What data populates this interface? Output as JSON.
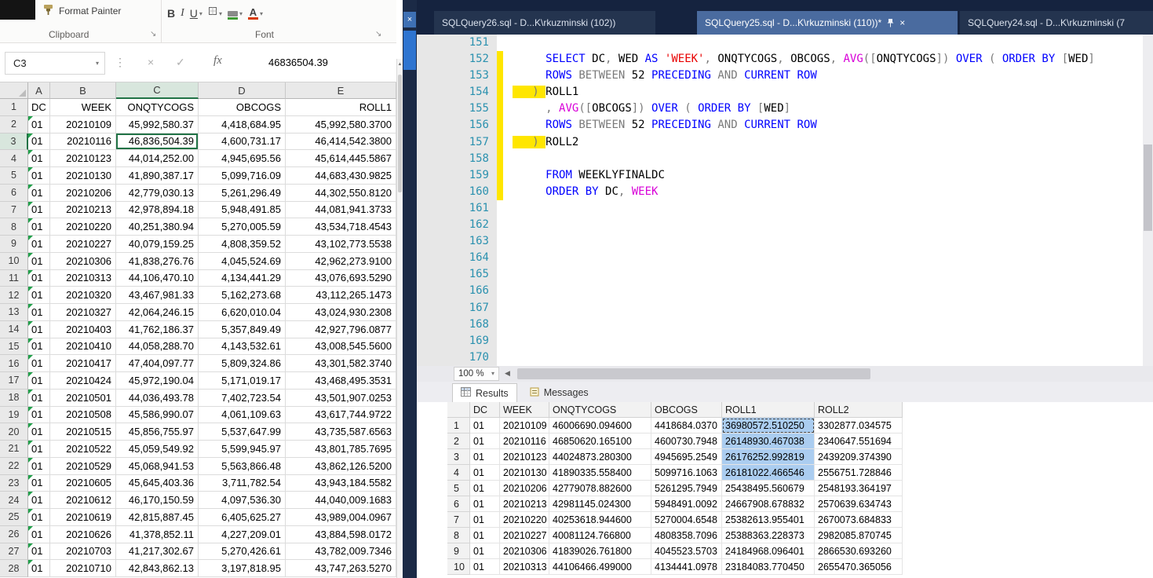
{
  "icons": {
    "dropdown_caret": "▾",
    "close": "×",
    "check": "✓",
    "dots": "⋮",
    "launcher": "↘",
    "scroll_up": "▲",
    "scroll_left": "◀"
  },
  "excel": {
    "ribbon": {
      "format_painter": "Format Painter",
      "clipboard_group": "Clipboard",
      "font_group": "Font",
      "bold": "B",
      "italic": "I",
      "underline": "U",
      "font_color_letter": "A"
    },
    "formula_row": {
      "name_box": "C3",
      "fx_label": "fx",
      "formula_value": "46836504.39"
    },
    "col_headers": [
      "A",
      "B",
      "C",
      "D",
      "E"
    ],
    "selection": {
      "ref": "C3",
      "row": 3,
      "col": 2
    },
    "sheet_rows": [
      [
        "DC",
        "WEEK",
        "ONQTYCOGS",
        "OBCOGS",
        "ROLL1"
      ],
      [
        "01",
        "20210109",
        "45,992,580.37",
        "4,418,684.95",
        "45,992,580.3700"
      ],
      [
        "01",
        "20210116",
        "46,836,504.39",
        "4,600,731.17",
        "46,414,542.3800"
      ],
      [
        "01",
        "20210123",
        "44,014,252.00",
        "4,945,695.56",
        "45,614,445.5867"
      ],
      [
        "01",
        "20210130",
        "41,890,387.17",
        "5,099,716.09",
        "44,683,430.9825"
      ],
      [
        "01",
        "20210206",
        "42,779,030.13",
        "5,261,296.49",
        "44,302,550.8120"
      ],
      [
        "01",
        "20210213",
        "42,978,894.18",
        "5,948,491.85",
        "44,081,941.3733"
      ],
      [
        "01",
        "20210220",
        "40,251,380.94",
        "5,270,005.59",
        "43,534,718.4543"
      ],
      [
        "01",
        "20210227",
        "40,079,159.25",
        "4,808,359.52",
        "43,102,773.5538"
      ],
      [
        "01",
        "20210306",
        "41,838,276.76",
        "4,045,524.69",
        "42,962,273.9100"
      ],
      [
        "01",
        "20210313",
        "44,106,470.10",
        "4,134,441.29",
        "43,076,693.5290"
      ],
      [
        "01",
        "20210320",
        "43,467,981.33",
        "5,162,273.68",
        "43,112,265.1473"
      ],
      [
        "01",
        "20210327",
        "42,064,246.15",
        "6,620,010.04",
        "43,024,930.2308"
      ],
      [
        "01",
        "20210403",
        "41,762,186.37",
        "5,357,849.49",
        "42,927,796.0877"
      ],
      [
        "01",
        "20210410",
        "44,058,288.70",
        "4,143,532.61",
        "43,008,545.5600"
      ],
      [
        "01",
        "20210417",
        "47,404,097.77",
        "5,809,324.86",
        "43,301,582.3740"
      ],
      [
        "01",
        "20210424",
        "45,972,190.04",
        "5,171,019.17",
        "43,468,495.3531"
      ],
      [
        "01",
        "20210501",
        "44,036,493.78",
        "7,402,723.54",
        "43,501,907.0253"
      ],
      [
        "01",
        "20210508",
        "45,586,990.07",
        "4,061,109.63",
        "43,617,744.9722"
      ],
      [
        "01",
        "20210515",
        "45,856,755.97",
        "5,537,647.99",
        "43,735,587.6563"
      ],
      [
        "01",
        "20210522",
        "45,059,549.92",
        "5,599,945.97",
        "43,801,785.7695"
      ],
      [
        "01",
        "20210529",
        "45,068,941.53",
        "5,563,866.48",
        "43,862,126.5200"
      ],
      [
        "01",
        "20210605",
        "45,645,403.36",
        "3,711,782.54",
        "43,943,184.5582"
      ],
      [
        "01",
        "20210612",
        "46,170,150.59",
        "4,097,536.30",
        "44,040,009.1683"
      ],
      [
        "01",
        "20210619",
        "42,815,887.45",
        "6,405,625.27",
        "43,989,004.0967"
      ],
      [
        "01",
        "20210626",
        "41,378,852.11",
        "4,227,209.01",
        "43,884,598.0172"
      ],
      [
        "01",
        "20210703",
        "41,217,302.67",
        "5,270,426.61",
        "43,782,009.7346"
      ],
      [
        "01",
        "20210710",
        "42,843,862.13",
        "3,197,818.95",
        "43,747,263.5270"
      ]
    ]
  },
  "ssms": {
    "tabs": [
      {
        "label": "SQLQuery26.sql - D...K\\rkuzminski (102))",
        "active": false
      },
      {
        "label": "SQLQuery25.sql - D...K\\rkuzminski (110))*",
        "active": true
      },
      {
        "label": "SQLQuery24.sql - D...K\\rkuzminski (7",
        "active": false
      }
    ],
    "editor": {
      "line_from": 151,
      "line_to": 170,
      "changed_lines": [
        152,
        153,
        154,
        155,
        156,
        157,
        158,
        159,
        160
      ],
      "code": {
        "152": [
          [
            "     ",
            "p"
          ],
          [
            "SELECT",
            "k"
          ],
          [
            " DC",
            "p"
          ],
          [
            ", ",
            "o"
          ],
          [
            "WED",
            "p"
          ],
          [
            " AS ",
            "k"
          ],
          [
            "'WEEK'",
            "s"
          ],
          [
            ", ",
            "o"
          ],
          [
            "ONQTYCOGS",
            "p"
          ],
          [
            ", ",
            "o"
          ],
          [
            "OBCOGS",
            "p"
          ],
          [
            ", ",
            "o"
          ],
          [
            "AVG",
            "f"
          ],
          [
            "([",
            "o"
          ],
          [
            "ONQTYCOGS",
            "p"
          ],
          [
            "]) ",
            "o"
          ],
          [
            "OVER",
            "k"
          ],
          [
            " ( ",
            "o"
          ],
          [
            "ORDER BY",
            "k"
          ],
          [
            " [",
            "o"
          ],
          [
            "WED",
            "p"
          ],
          [
            "]",
            "o"
          ]
        ],
        "153": [
          [
            "     ",
            "p"
          ],
          [
            "ROWS ",
            "k"
          ],
          [
            "BETWEEN ",
            "o"
          ],
          [
            "52 ",
            "p"
          ],
          [
            "PRECEDING ",
            "k"
          ],
          [
            "AND ",
            "o"
          ],
          [
            "CURRENT ROW",
            "k"
          ]
        ],
        "154": [
          [
            "   ) ",
            "o hl"
          ],
          [
            "ROLL1",
            "p"
          ]
        ],
        "155": [
          [
            "     ",
            "p"
          ],
          [
            ", ",
            "o"
          ],
          [
            "AVG",
            "f"
          ],
          [
            "([",
            "o"
          ],
          [
            "OBCOGS",
            "p"
          ],
          [
            "]) ",
            "o"
          ],
          [
            "OVER",
            "k"
          ],
          [
            " ( ",
            "o"
          ],
          [
            "ORDER BY",
            "k"
          ],
          [
            " [",
            "o"
          ],
          [
            "WED",
            "p"
          ],
          [
            "]",
            "o"
          ]
        ],
        "156": [
          [
            "     ",
            "p"
          ],
          [
            "ROWS ",
            "k"
          ],
          [
            "BETWEEN ",
            "o"
          ],
          [
            "52 ",
            "p"
          ],
          [
            "PRECEDING ",
            "k"
          ],
          [
            "AND ",
            "o"
          ],
          [
            "CURRENT ROW",
            "k"
          ]
        ],
        "157": [
          [
            "   ) ",
            "o hl"
          ],
          [
            "ROLL2",
            "p"
          ]
        ],
        "159": [
          [
            "     ",
            "p"
          ],
          [
            "FROM",
            "k"
          ],
          [
            " WEEKLYFINALDC",
            "p"
          ]
        ],
        "160": [
          [
            "     ",
            "p"
          ],
          [
            "ORDER BY",
            "k"
          ],
          [
            " DC",
            "p"
          ],
          [
            ", ",
            "o"
          ],
          [
            "WEEK",
            "f"
          ]
        ]
      }
    },
    "zoom_level": "100 %",
    "results_pane": {
      "results_tab": "Results",
      "messages_tab": "Messages",
      "columns": [
        "DC",
        "WEEK",
        "ONQTYCOGS",
        "OBCOGS",
        "ROLL1",
        "ROLL2"
      ],
      "rows": [
        [
          "01",
          "20210109",
          "46006690.094600",
          "4418684.0370",
          "36980572.510250",
          "3302877.034575"
        ],
        [
          "01",
          "20210116",
          "46850620.165100",
          "4600730.7948",
          "26148930.467038",
          "2340647.551694"
        ],
        [
          "01",
          "20210123",
          "44024873.280300",
          "4945695.2549",
          "26176252.992819",
          "2439209.374390"
        ],
        [
          "01",
          "20210130",
          "41890335.558400",
          "5099716.1063",
          "26181022.466546",
          "2556751.728846"
        ],
        [
          "01",
          "20210206",
          "42779078.882600",
          "5261295.7949",
          "25438495.560679",
          "2548193.364197"
        ],
        [
          "01",
          "20210213",
          "42981145.024300",
          "5948491.0092",
          "24667908.678832",
          "2570639.634743"
        ],
        [
          "01",
          "20210220",
          "40253618.944600",
          "5270004.6548",
          "25382613.955401",
          "2670073.684833"
        ],
        [
          "01",
          "20210227",
          "40081124.766800",
          "4808358.7096",
          "25388363.228373",
          "2982085.870745"
        ],
        [
          "01",
          "20210306",
          "41839026.761800",
          "4045523.5703",
          "24184968.096401",
          "2866530.693260"
        ],
        [
          "01",
          "20210313",
          "44106466.499000",
          "4134441.0978",
          "23184083.770450",
          "2655470.365056"
        ]
      ],
      "selection": {
        "column": "ROLL1",
        "col_index": 4,
        "row_numbers": [
          1,
          2,
          3,
          4
        ],
        "focus_row": 1
      }
    }
  },
  "colors": {
    "keyword": "#0000ff",
    "string": "#e80000",
    "function": "#d800d8",
    "operator": "#7a7a7a",
    "line_number": "#2b91af",
    "change_bar": "#ffe600",
    "highlight": "#ffe600",
    "tab_bar": "#15233f",
    "active_tab": "#4a6b9f",
    "excel_selection_green": "#217346",
    "grid_selection_blue": "#abcdf0"
  }
}
